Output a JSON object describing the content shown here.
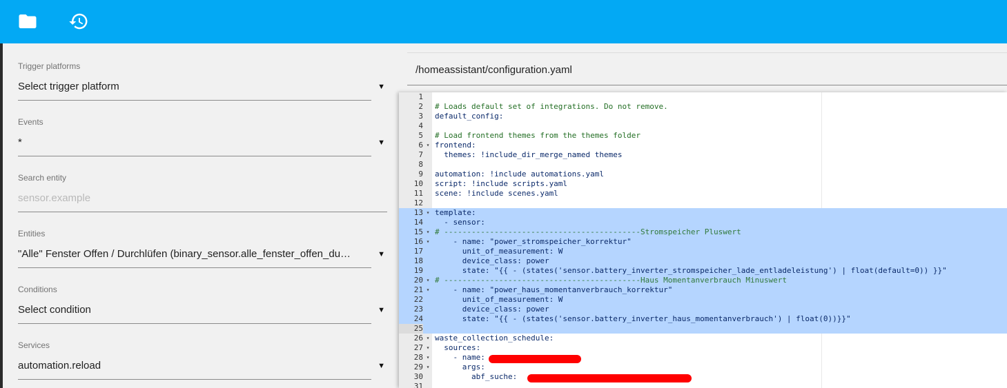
{
  "toolbar": {
    "folder_icon": "folder-icon",
    "history_icon": "history-icon",
    "accent": "#03a9f4"
  },
  "sidebar": {
    "trigger_platforms": {
      "label": "Trigger platforms",
      "value": "Select trigger platform"
    },
    "events": {
      "label": "Events",
      "value": "*"
    },
    "search_entity": {
      "label": "Search entity",
      "placeholder": "sensor.example"
    },
    "entities": {
      "label": "Entities",
      "value": "\"Alle\" Fenster Offen / Durchlüfen (binary_sensor.alle_fenster_offen_durchlüften)"
    },
    "conditions": {
      "label": "Conditions",
      "value": "Select condition"
    },
    "services": {
      "label": "Services",
      "value": "automation.reload"
    }
  },
  "editor": {
    "path": "/homeassistant/configuration.yaml",
    "lines": [
      {
        "n": "1",
        "code": "",
        "fold": ""
      },
      {
        "n": "2",
        "code": "# Loads default set of integrations. Do not remove.",
        "fold": ""
      },
      {
        "n": "3",
        "code": "default_config:",
        "fold": ""
      },
      {
        "n": "4",
        "code": "",
        "fold": ""
      },
      {
        "n": "5",
        "code": "# Load frontend themes from the themes folder",
        "fold": ""
      },
      {
        "n": "6",
        "code": "frontend:",
        "fold": "▾"
      },
      {
        "n": "7",
        "code": "  themes: !include_dir_merge_named themes",
        "fold": ""
      },
      {
        "n": "8",
        "code": "",
        "fold": ""
      },
      {
        "n": "9",
        "code": "automation: !include automations.yaml",
        "fold": ""
      },
      {
        "n": "10",
        "code": "script: !include scripts.yaml",
        "fold": ""
      },
      {
        "n": "11",
        "code": "scene: !include scenes.yaml",
        "fold": ""
      },
      {
        "n": "12",
        "code": "",
        "fold": ""
      },
      {
        "n": "13",
        "code": "template:",
        "fold": "▾"
      },
      {
        "n": "14",
        "code": "  - sensor:",
        "fold": ""
      },
      {
        "n": "15",
        "code": "# -------------------------------------------Stromspeicher Pluswert",
        "fold": "▾"
      },
      {
        "n": "16",
        "code": "    - name: \"power_stromspeicher_korrektur\"",
        "fold": "▾"
      },
      {
        "n": "17",
        "code": "      unit_of_measurement: W",
        "fold": ""
      },
      {
        "n": "18",
        "code": "      device_class: power",
        "fold": ""
      },
      {
        "n": "19",
        "code": "      state: \"{{ - (states('sensor.battery_inverter_stromspeicher_lade_entladeleistung') | float(default=0)) }}\"",
        "fold": ""
      },
      {
        "n": "20",
        "code": "# -------------------------------------------Haus Momentanverbrauch Minuswert",
        "fold": "▾"
      },
      {
        "n": "21",
        "code": "    - name: \"power_haus_momentanverbrauch_korrektur\"",
        "fold": "▾"
      },
      {
        "n": "22",
        "code": "      unit_of_measurement: W",
        "fold": ""
      },
      {
        "n": "23",
        "code": "      device_class: power",
        "fold": ""
      },
      {
        "n": "24",
        "code": "      state: \"{{ - (states('sensor.battery_inverter_haus_momentanverbrauch') | float(0))}}\"",
        "fold": ""
      },
      {
        "n": "25",
        "code": "",
        "fold": ""
      },
      {
        "n": "26",
        "code": "waste_collection_schedule:",
        "fold": "▾"
      },
      {
        "n": "27",
        "code": "  sources:",
        "fold": "▾"
      },
      {
        "n": "28",
        "code": "    - name:",
        "fold": "▾"
      },
      {
        "n": "29",
        "code": "      args:",
        "fold": "▾"
      },
      {
        "n": "30",
        "code": "        abf_suche:",
        "fold": ""
      },
      {
        "n": "31",
        "code": "",
        "fold": ""
      }
    ],
    "selected_lines": [
      "13",
      "14",
      "15",
      "16",
      "17",
      "18",
      "19",
      "20",
      "21",
      "22",
      "23",
      "24",
      "25"
    ],
    "comment_lines": [
      "2",
      "5",
      "15",
      "20"
    ]
  }
}
